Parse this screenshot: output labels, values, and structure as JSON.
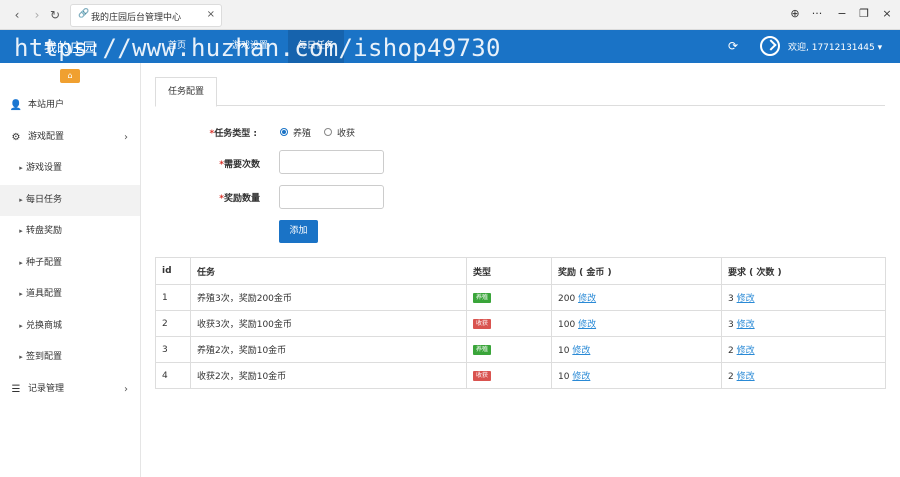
{
  "browser": {
    "tab_title": "我的庄园后台管理中心",
    "back": "‹",
    "forward": "›",
    "reload": "↻",
    "close_tab": "×",
    "globe": "⊕",
    "more": "···",
    "minimize": "−",
    "restore": "❐",
    "close": "×"
  },
  "header": {
    "brand": "我的庄园",
    "nav": [
      "首页",
      "游戏设置",
      "每日任务"
    ],
    "active_nav": "每日任务",
    "welcome": "欢迎, 17712131445 ▾",
    "watermark": "https://www.huzhan.com/ishop49730"
  },
  "sidebar": {
    "items": [
      {
        "label": "本站用户",
        "icon": "user-icon",
        "glyph": "👤"
      },
      {
        "label": "游戏配置",
        "icon": "gears-icon",
        "glyph": "⚙",
        "chevron": "›"
      },
      {
        "label": "游戏设置",
        "sub": true
      },
      {
        "label": "每日任务",
        "sub": true,
        "active": true
      },
      {
        "label": "转盘奖励",
        "sub": true
      },
      {
        "label": "种子配置",
        "sub": true
      },
      {
        "label": "道具配置",
        "sub": true
      },
      {
        "label": "兑换商城",
        "sub": true
      },
      {
        "label": "签到配置",
        "sub": true
      },
      {
        "label": "记录管理",
        "icon": "list-icon",
        "glyph": "☰",
        "chevron": "›"
      }
    ]
  },
  "main": {
    "tab": "任务配置",
    "form": {
      "type_label": "任务类型 :",
      "type_options": [
        "养殖",
        "收获"
      ],
      "type_selected": "养殖",
      "count_label": "需要次数",
      "reward_label": "奖励数量",
      "count_value": "",
      "reward_value": "",
      "add_button": "添加"
    },
    "table": {
      "headers": [
        "id",
        "任务",
        "类型",
        "奖励 ( 金币 )",
        "要求 ( 次数 )"
      ],
      "edit_label": "修改",
      "rows": [
        {
          "id": "1",
          "task": "养殖3次，奖励200金币",
          "type": "养殖",
          "type_color": "#3aa53a",
          "reward": "200",
          "require": "3"
        },
        {
          "id": "2",
          "task": "收获3次，奖励100金币",
          "type": "收获",
          "type_color": "#d9534f",
          "reward": "100",
          "require": "3"
        },
        {
          "id": "3",
          "task": "养殖2次，奖励10金币",
          "type": "养殖",
          "type_color": "#3aa53a",
          "reward": "10",
          "require": "2"
        },
        {
          "id": "4",
          "task": "收获2次，奖励10金币",
          "type": "收获",
          "type_color": "#d9534f",
          "reward": "10",
          "require": "2"
        }
      ]
    }
  },
  "colors": {
    "primary": "#1a73c6",
    "accent": "#f0a030",
    "link": "#2a8ad6"
  }
}
